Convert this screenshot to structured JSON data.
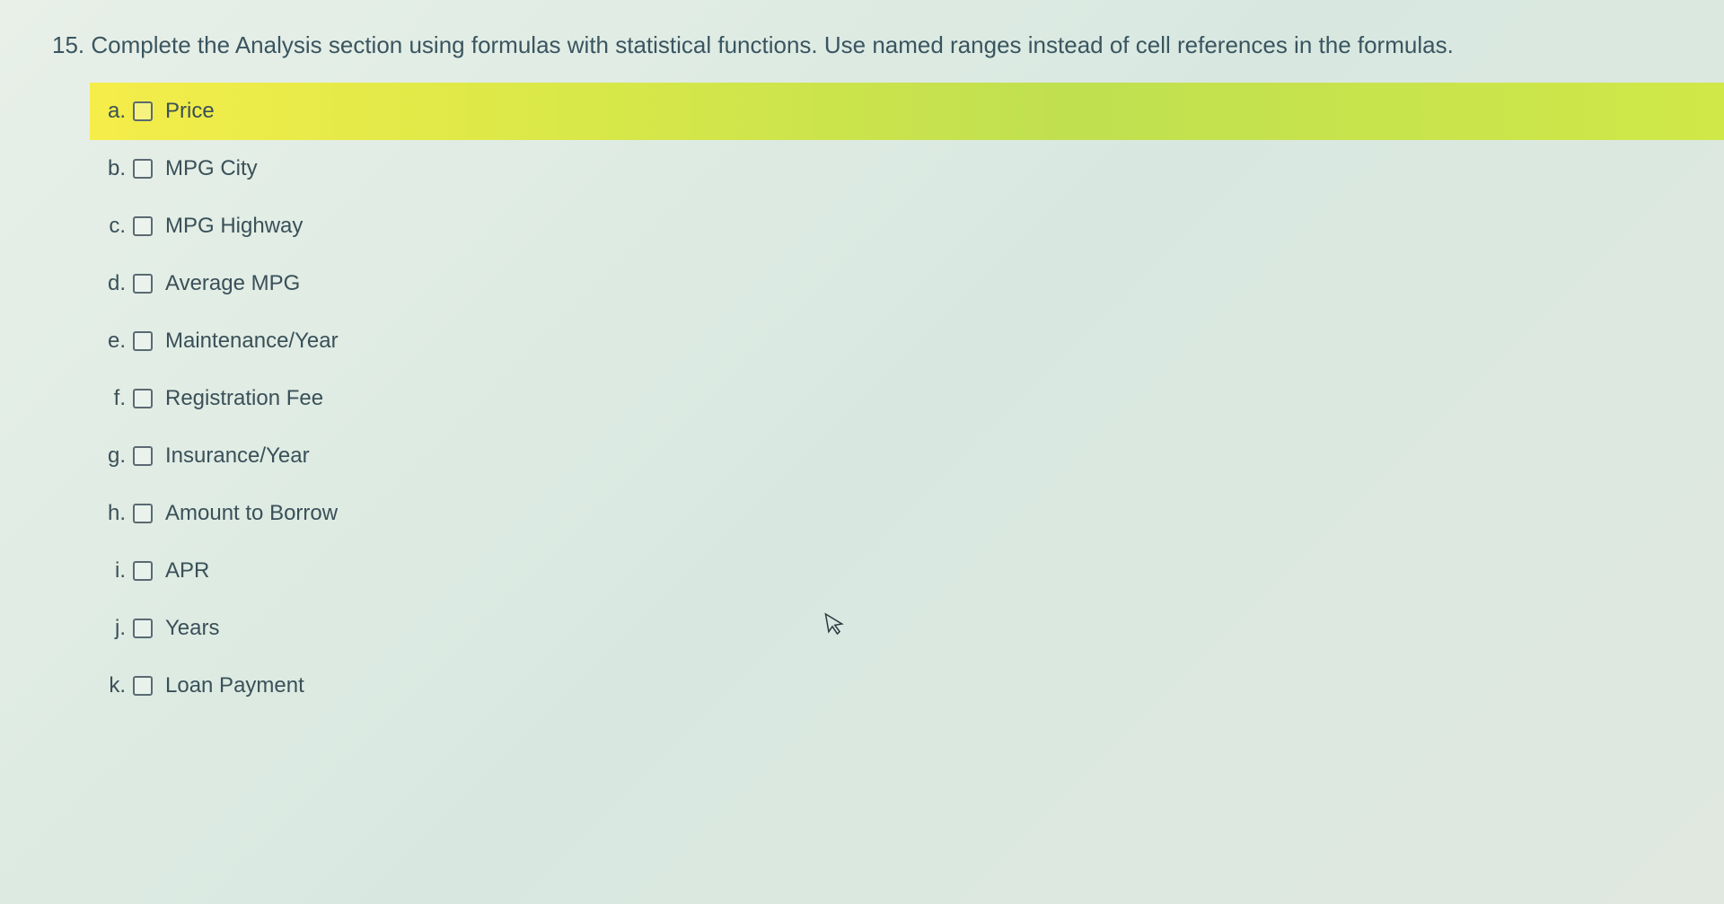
{
  "question": {
    "number": "15.",
    "text": "Complete the Analysis section using formulas with statistical functions. Use named ranges instead of cell references in the formulas."
  },
  "items": [
    {
      "letter": "a.",
      "label": "Price",
      "highlighted": true
    },
    {
      "letter": "b.",
      "label": "MPG City",
      "highlighted": false
    },
    {
      "letter": "c.",
      "label": "MPG Highway",
      "highlighted": false
    },
    {
      "letter": "d.",
      "label": "Average MPG",
      "highlighted": false
    },
    {
      "letter": "e.",
      "label": "Maintenance/Year",
      "highlighted": false
    },
    {
      "letter": "f.",
      "label": "Registration Fee",
      "highlighted": false
    },
    {
      "letter": "g.",
      "label": "Insurance/Year",
      "highlighted": false
    },
    {
      "letter": "h.",
      "label": "Amount to Borrow",
      "highlighted": false
    },
    {
      "letter": "i.",
      "label": "APR",
      "highlighted": false
    },
    {
      "letter": "j.",
      "label": "Years",
      "highlighted": false
    },
    {
      "letter": "k.",
      "label": "Loan Payment",
      "highlighted": false
    }
  ]
}
